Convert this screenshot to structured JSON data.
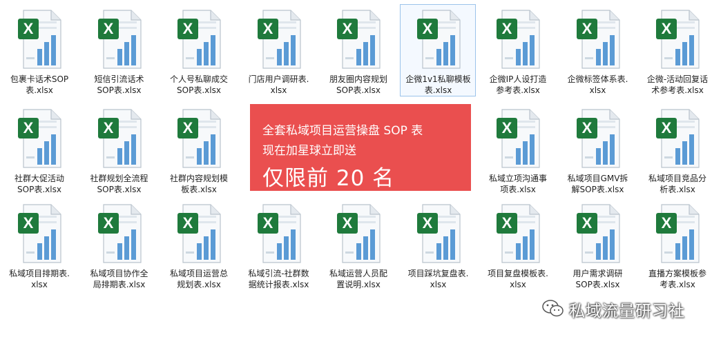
{
  "files": [
    {
      "label": "包裹卡话术SOP\n表.xlsx",
      "selected": false
    },
    {
      "label": "短信引流话术\nSOP表.xlsx",
      "selected": false
    },
    {
      "label": "个人号私聊成交\nSOP表.xlsx",
      "selected": false
    },
    {
      "label": "门店用户调研表.\nxlsx",
      "selected": false
    },
    {
      "label": "朋友圈内容规划\nSOP表.xlsx",
      "selected": false
    },
    {
      "label": "企微1v1私聊模板\n表.xlsx",
      "selected": true
    },
    {
      "label": "企微IP人设打造\n参考表.xlsx",
      "selected": false
    },
    {
      "label": "企微标签体系表.\nxlsx",
      "selected": false
    },
    {
      "label": "企微-活动回复话\n术参考表.xlsx",
      "selected": false
    },
    {
      "label": "社群大促活动\nSOP表.xlsx",
      "selected": false
    },
    {
      "label": "社群规划全流程\nSOP表.xlsx",
      "selected": false
    },
    {
      "label": "社群内容规划模\n板表.xlsx",
      "selected": false
    },
    {
      "label": "私域立项沟通事\n项表.xlsx",
      "selected": false
    },
    {
      "label": "私域项目GMV拆\n解SOP表.xlsx",
      "selected": false
    },
    {
      "label": "私域项目竞品分\n析表.xlsx",
      "selected": false
    },
    {
      "label": "私域项目排期表.\nxlsx",
      "selected": false
    },
    {
      "label": "私域项目协作全\n局排期表.xlsx",
      "selected": false
    },
    {
      "label": "私域项目运营总\n规划表.xlsx",
      "selected": false
    },
    {
      "label": "私域引流-社群数\n据统计报表.xlsx",
      "selected": false
    },
    {
      "label": "私域运营人员配\n置说明.xlsx",
      "selected": false
    },
    {
      "label": "项目踩坑复盘表.\nxlsx",
      "selected": false
    },
    {
      "label": "项目复盘模板表.\nxlsx",
      "selected": false
    },
    {
      "label": "用户需求调研\nSOP表.xlsx",
      "selected": false
    },
    {
      "label": "直播方案模板参\n考表.xlsx",
      "selected": false
    }
  ],
  "banner": {
    "line1": "全套私域项目运营操盘 SOP 表",
    "line2": "现在加星球立即送",
    "line3": "仅限前 20 名",
    "color": "#ea4f4f"
  },
  "watermark": {
    "text": "私域流量研习社",
    "icon": "wechat-icon"
  },
  "icon_name": "excel-file-icon",
  "colors": {
    "excel_green": "#1f7a3c",
    "bar_blue": "#5b9bd5"
  }
}
